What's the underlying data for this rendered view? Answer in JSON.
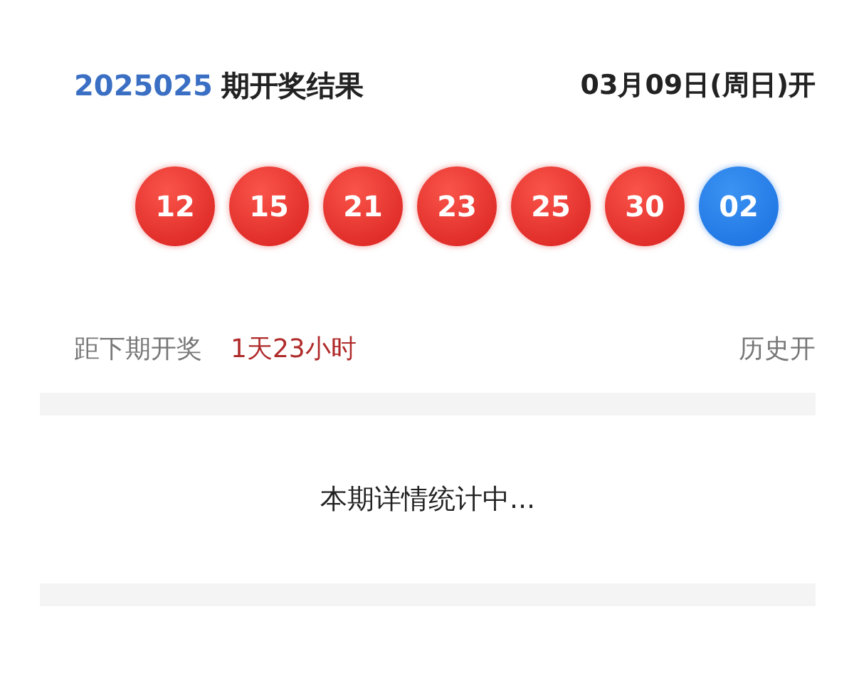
{
  "header": {
    "issue": "2025025",
    "issue_suffix": "期开奖结果",
    "draw_date": "03月09日(周日)开"
  },
  "balls": [
    {
      "number": "12",
      "kind": "red"
    },
    {
      "number": "15",
      "kind": "red"
    },
    {
      "number": "21",
      "kind": "red"
    },
    {
      "number": "23",
      "kind": "red"
    },
    {
      "number": "25",
      "kind": "red"
    },
    {
      "number": "30",
      "kind": "red"
    },
    {
      "number": "02",
      "kind": "blue"
    }
  ],
  "countdown": {
    "label": "距下期开奖",
    "value": "1天23小时",
    "history_link": "历史开"
  },
  "details_message": "本期详情统计中..."
}
